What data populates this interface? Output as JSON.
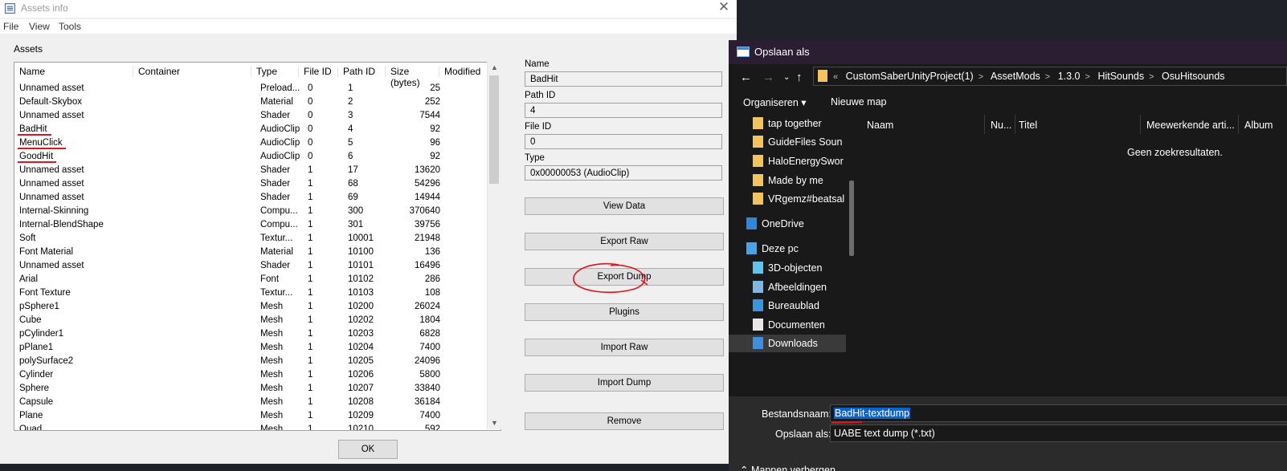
{
  "assets_window": {
    "title": "Assets info",
    "close_glyph": "✕",
    "menu": [
      "File",
      "View",
      "Tools"
    ],
    "group_label": "Assets",
    "columns": [
      "Name",
      "Container",
      "Type",
      "File ID",
      "Path ID",
      "Size (bytes)",
      "Modified"
    ],
    "rows": [
      {
        "name": "Unnamed asset",
        "type": "Preload...",
        "file_id": "0",
        "path_id": "1",
        "size": "25"
      },
      {
        "name": "Default-Skybox",
        "type": "Material",
        "file_id": "0",
        "path_id": "2",
        "size": "252"
      },
      {
        "name": "Unnamed asset",
        "type": "Shader",
        "file_id": "0",
        "path_id": "3",
        "size": "7544"
      },
      {
        "name": "BadHit",
        "type": "AudioClip",
        "file_id": "0",
        "path_id": "4",
        "size": "92",
        "underline": true
      },
      {
        "name": "MenuClick",
        "type": "AudioClip",
        "file_id": "0",
        "path_id": "5",
        "size": "96",
        "underline": true
      },
      {
        "name": "GoodHit",
        "type": "AudioClip",
        "file_id": "0",
        "path_id": "6",
        "size": "92",
        "underline": true
      },
      {
        "name": "Unnamed asset",
        "type": "Shader",
        "file_id": "1",
        "path_id": "17",
        "size": "13620"
      },
      {
        "name": "Unnamed asset",
        "type": "Shader",
        "file_id": "1",
        "path_id": "68",
        "size": "54296"
      },
      {
        "name": "Unnamed asset",
        "type": "Shader",
        "file_id": "1",
        "path_id": "69",
        "size": "14944"
      },
      {
        "name": "Internal-Skinning",
        "type": "Compu...",
        "file_id": "1",
        "path_id": "300",
        "size": "370640"
      },
      {
        "name": "Internal-BlendShape",
        "type": "Compu...",
        "file_id": "1",
        "path_id": "301",
        "size": "39756"
      },
      {
        "name": "Soft",
        "type": "Textur...",
        "file_id": "1",
        "path_id": "10001",
        "size": "21948"
      },
      {
        "name": "Font Material",
        "type": "Material",
        "file_id": "1",
        "path_id": "10100",
        "size": "136"
      },
      {
        "name": "Unnamed asset",
        "type": "Shader",
        "file_id": "1",
        "path_id": "10101",
        "size": "16496"
      },
      {
        "name": "Arial",
        "type": "Font",
        "file_id": "1",
        "path_id": "10102",
        "size": "286"
      },
      {
        "name": "Font Texture",
        "type": "Textur...",
        "file_id": "1",
        "path_id": "10103",
        "size": "108"
      },
      {
        "name": "pSphere1",
        "type": "Mesh",
        "file_id": "1",
        "path_id": "10200",
        "size": "26024"
      },
      {
        "name": "Cube",
        "type": "Mesh",
        "file_id": "1",
        "path_id": "10202",
        "size": "1804"
      },
      {
        "name": "pCylinder1",
        "type": "Mesh",
        "file_id": "1",
        "path_id": "10203",
        "size": "6828"
      },
      {
        "name": "pPlane1",
        "type": "Mesh",
        "file_id": "1",
        "path_id": "10204",
        "size": "7400"
      },
      {
        "name": "polySurface2",
        "type": "Mesh",
        "file_id": "1",
        "path_id": "10205",
        "size": "24096"
      },
      {
        "name": "Cylinder",
        "type": "Mesh",
        "file_id": "1",
        "path_id": "10206",
        "size": "5800"
      },
      {
        "name": "Sphere",
        "type": "Mesh",
        "file_id": "1",
        "path_id": "10207",
        "size": "33840"
      },
      {
        "name": "Capsule",
        "type": "Mesh",
        "file_id": "1",
        "path_id": "10208",
        "size": "36184"
      },
      {
        "name": "Plane",
        "type": "Mesh",
        "file_id": "1",
        "path_id": "10209",
        "size": "7400"
      },
      {
        "name": "Quad",
        "type": "Mesh",
        "file_id": "1",
        "path_id": "10210",
        "size": "592"
      }
    ],
    "properties": {
      "name_label": "Name",
      "name_value": "BadHit",
      "path_id_label": "Path ID",
      "path_id_value": "4",
      "file_id_label": "File ID",
      "file_id_value": "0",
      "type_label": "Type",
      "type_value": "0x00000053 (AudioClip)"
    },
    "buttons": {
      "view_data": "View Data",
      "export_raw": "Export Raw",
      "export_dump": "Export Dump",
      "plugins": "Plugins",
      "import_raw": "Import Raw",
      "import_dump": "Import Dump",
      "remove": "Remove",
      "ok": "OK"
    },
    "annotation_color": "#e0141e"
  },
  "save_dialog": {
    "title": "Opslaan als",
    "breadcrumb": [
      "CustomSaberUnityProject(1)",
      "AssetMods",
      "1.3.0",
      "HitSounds",
      "OsuHitsounds"
    ],
    "breadcrumb_prefix": "«",
    "toolbar": {
      "organize": "Organiseren",
      "new_folder": "Nieuwe map"
    },
    "nav_items": [
      {
        "label": "tap together",
        "icon": "folder-icon"
      },
      {
        "label": "GuideFiles Soun",
        "icon": "folder-icon"
      },
      {
        "label": "HaloEnergySwor",
        "icon": "folder-icon"
      },
      {
        "label": "Made by me",
        "icon": "folder-icon"
      },
      {
        "label": "VRgemz#beatsal",
        "icon": "folder-icon"
      },
      {
        "label": "OneDrive",
        "icon": "cloud-icon"
      },
      {
        "label": "Deze pc",
        "icon": "computer-icon"
      },
      {
        "label": "3D-objecten",
        "icon": "cube-icon"
      },
      {
        "label": "Afbeeldingen",
        "icon": "image-icon"
      },
      {
        "label": "Bureaublad",
        "icon": "desktop-icon"
      },
      {
        "label": "Documenten",
        "icon": "document-icon"
      },
      {
        "label": "Downloads",
        "icon": "download-icon"
      }
    ],
    "columns": [
      "Naam",
      "Nu...",
      "Titel",
      "Meewerkende arti...",
      "Album"
    ],
    "no_results": "Geen zoekresultaten.",
    "filename_label": "Bestandsnaam:",
    "filename_value": "BadHit-textdump",
    "savetype_label": "Opslaan als:",
    "savetype_value": "UABE text dump (*.txt)",
    "hide_folders": "Mappen verbergen",
    "accent_color": "#0a64d0"
  }
}
